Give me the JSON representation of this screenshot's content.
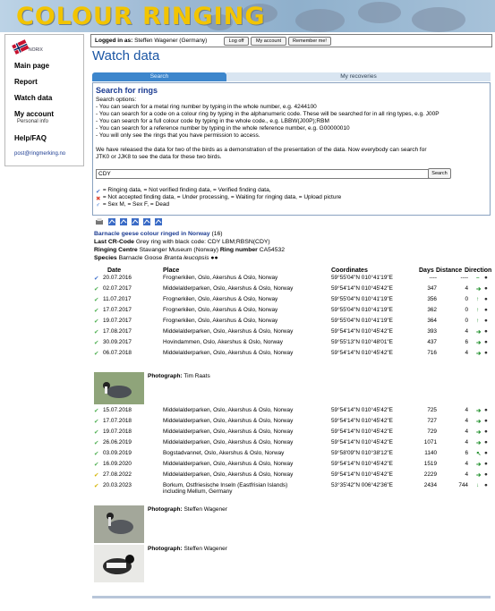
{
  "banner": {
    "title": "COLOUR RINGING"
  },
  "sidebar": {
    "logo_text": "NORIX",
    "items": [
      {
        "label": "Main page"
      },
      {
        "label": "Report"
      },
      {
        "label": "Watch data"
      },
      {
        "label": "My account",
        "sub": "Personal info"
      },
      {
        "label": "Help/FAQ"
      }
    ],
    "email": "post@ringmerking.no"
  },
  "login": {
    "label": "Logged in as:",
    "user": "Steffen Wagener (Germany)",
    "logoff": "Log off",
    "my_account": "My account",
    "remember": "Remember me!"
  },
  "page_title": "Watch data",
  "tabs": {
    "search": "Search",
    "recoveries": "My recoveries"
  },
  "search": {
    "title": "Search for rings",
    "options_label": "Search options:",
    "lines": [
      "- You can search for a metal ring number by typing in the whole number, e.g. 4244100",
      "- You can search for a code on a colour ring by typing in the alphanumeric code. These will be searched for in all ring types, e.g. J00P",
      "- You can search for a full colour code by typing in the whole code., e.g. LBBW(J00P);RBM",
      "- You can search for a reference number by typing in the whole reference number, e.g. G00000010",
      "- You will only see the rings that you have permission to access."
    ],
    "demo_line1": "We have released the data for two of the birds as a demonstration of the presentation of the data. Now everybody can search for",
    "demo_line2": "JTK0 or JJK8 to see the data for these two birds.",
    "input_value": "CDY",
    "button": "Search",
    "legend1": "= Ringing data,      = Not verified finding data,      = Verified finding data,",
    "legend2": "= Not accepted finding data,      = Under processing,      = Waiting for ringing data,      = Upload picture",
    "legend3": "= Sex M,      = Sex F,      = Dead"
  },
  "bird": {
    "heading": "Barnacle geese colour ringed in Norway",
    "count": "(16)",
    "crcode_label": "Last CR-Code",
    "crcode": "Grey ring with black code: CDY LBM;RBSN(CDY)",
    "centre_label": "Ringing Centre",
    "centre": "Stavanger Museum (Norway)",
    "ringno_label": "Ring number",
    "ringno": "CA54532",
    "species_label": "Species",
    "species": "Barnacle Goose",
    "species_latin": "Branta leucopsis"
  },
  "table": {
    "headers": [
      "Date",
      "Place",
      "Coordinates",
      "Days",
      "Distance",
      "Direction"
    ],
    "rows": [
      {
        "date": "20.07.2016",
        "place": "Frognerkilen, Oslo, Akershus & Oslo, Norway",
        "coord": "59°55'04\"N 010°41'19\"E",
        "days": "----",
        "dist": "----",
        "dir": "-"
      },
      {
        "date": "02.07.2017",
        "place": "Middelalderparken, Oslo, Akershus & Oslo, Norway",
        "coord": "59°54'14\"N 010°45'42\"E",
        "days": "347",
        "dist": "4",
        "dir": "E"
      },
      {
        "date": "11.07.2017",
        "place": "Frognerkilen, Oslo, Akershus & Oslo, Norway",
        "coord": "59°55'04\"N 010°41'19\"E",
        "days": "356",
        "dist": "0",
        "dir": "N"
      },
      {
        "date": "17.07.2017",
        "place": "Frognerkilen, Oslo, Akershus & Oslo, Norway",
        "coord": "59°55'04\"N 010°41'19\"E",
        "days": "362",
        "dist": "0",
        "dir": "N"
      },
      {
        "date": "19.07.2017",
        "place": "Frognerkilen, Oslo, Akershus & Oslo, Norway",
        "coord": "59°55'04\"N 010°41'19\"E",
        "days": "364",
        "dist": "0",
        "dir": "N"
      },
      {
        "date": "17.08.2017",
        "place": "Middelalderparken, Oslo, Akershus & Oslo, Norway",
        "coord": "59°54'14\"N 010°45'42\"E",
        "days": "393",
        "dist": "4",
        "dir": "E"
      },
      {
        "date": "30.09.2017",
        "place": "Hovindammen, Oslo, Akershus & Oslo, Norway",
        "coord": "59°55'13\"N 010°48'01\"E",
        "days": "437",
        "dist": "6",
        "dir": "E"
      },
      {
        "date": "06.07.2018",
        "place": "Middelalderparken, Oslo, Akershus & Oslo, Norway",
        "coord": "59°54'14\"N 010°45'42\"E",
        "days": "716",
        "dist": "4",
        "dir": "E"
      },
      {
        "date": "15.07.2018",
        "place": "Middelalderparken, Oslo, Akershus & Oslo, Norway",
        "coord": "59°54'14\"N 010°45'42\"E",
        "days": "725",
        "dist": "4",
        "dir": "E"
      },
      {
        "date": "17.07.2018",
        "place": "Middelalderparken, Oslo, Akershus & Oslo, Norway",
        "coord": "59°54'14\"N 010°45'42\"E",
        "days": "727",
        "dist": "4",
        "dir": "E"
      },
      {
        "date": "19.07.2018",
        "place": "Middelalderparken, Oslo, Akershus & Oslo, Norway",
        "coord": "59°54'14\"N 010°45'42\"E",
        "days": "729",
        "dist": "4",
        "dir": "E"
      },
      {
        "date": "26.06.2019",
        "place": "Middelalderparken, Oslo, Akershus & Oslo, Norway",
        "coord": "59°54'14\"N 010°45'42\"E",
        "days": "1071",
        "dist": "4",
        "dir": "E"
      },
      {
        "date": "03.09.2019",
        "place": "Bogstadvannet, Oslo, Akershus & Oslo, Norway",
        "coord": "59°58'09\"N 010°38'12\"E",
        "days": "1140",
        "dist": "6",
        "dir": "NW"
      },
      {
        "date": "16.09.2020",
        "place": "Middelalderparken, Oslo, Akershus & Oslo, Norway",
        "coord": "59°54'14\"N 010°45'42\"E",
        "days": "1519",
        "dist": "4",
        "dir": "E"
      },
      {
        "date": "27.08.2022",
        "place": "Middelalderparken, Oslo, Akershus & Oslo, Norway",
        "coord": "59°54'14\"N 010°45'42\"E",
        "days": "2229",
        "dist": "4",
        "dir": "E"
      },
      {
        "date": "20.03.2023",
        "place": "Borkum, Ostfriesische Inseln (Eastfrisian Islands)",
        "place2": "including Mellum, Germany",
        "coord": "53°35'42\"N 006°42'36\"E",
        "days": "2434",
        "dist": "744",
        "dir": "S"
      }
    ]
  },
  "photos": [
    {
      "label": "Photograph:",
      "credit": "Tim Raats"
    },
    {
      "label": "Photograph:",
      "credit": "Steffen Wagener"
    },
    {
      "label": "Photograph:",
      "credit": "Steffen Wagener"
    }
  ],
  "colors": {
    "brand_blue": "#1b56a4",
    "tab_blue": "#3d86cc",
    "banner_yellow": "#f2c400",
    "check_green": "#4caf50"
  }
}
